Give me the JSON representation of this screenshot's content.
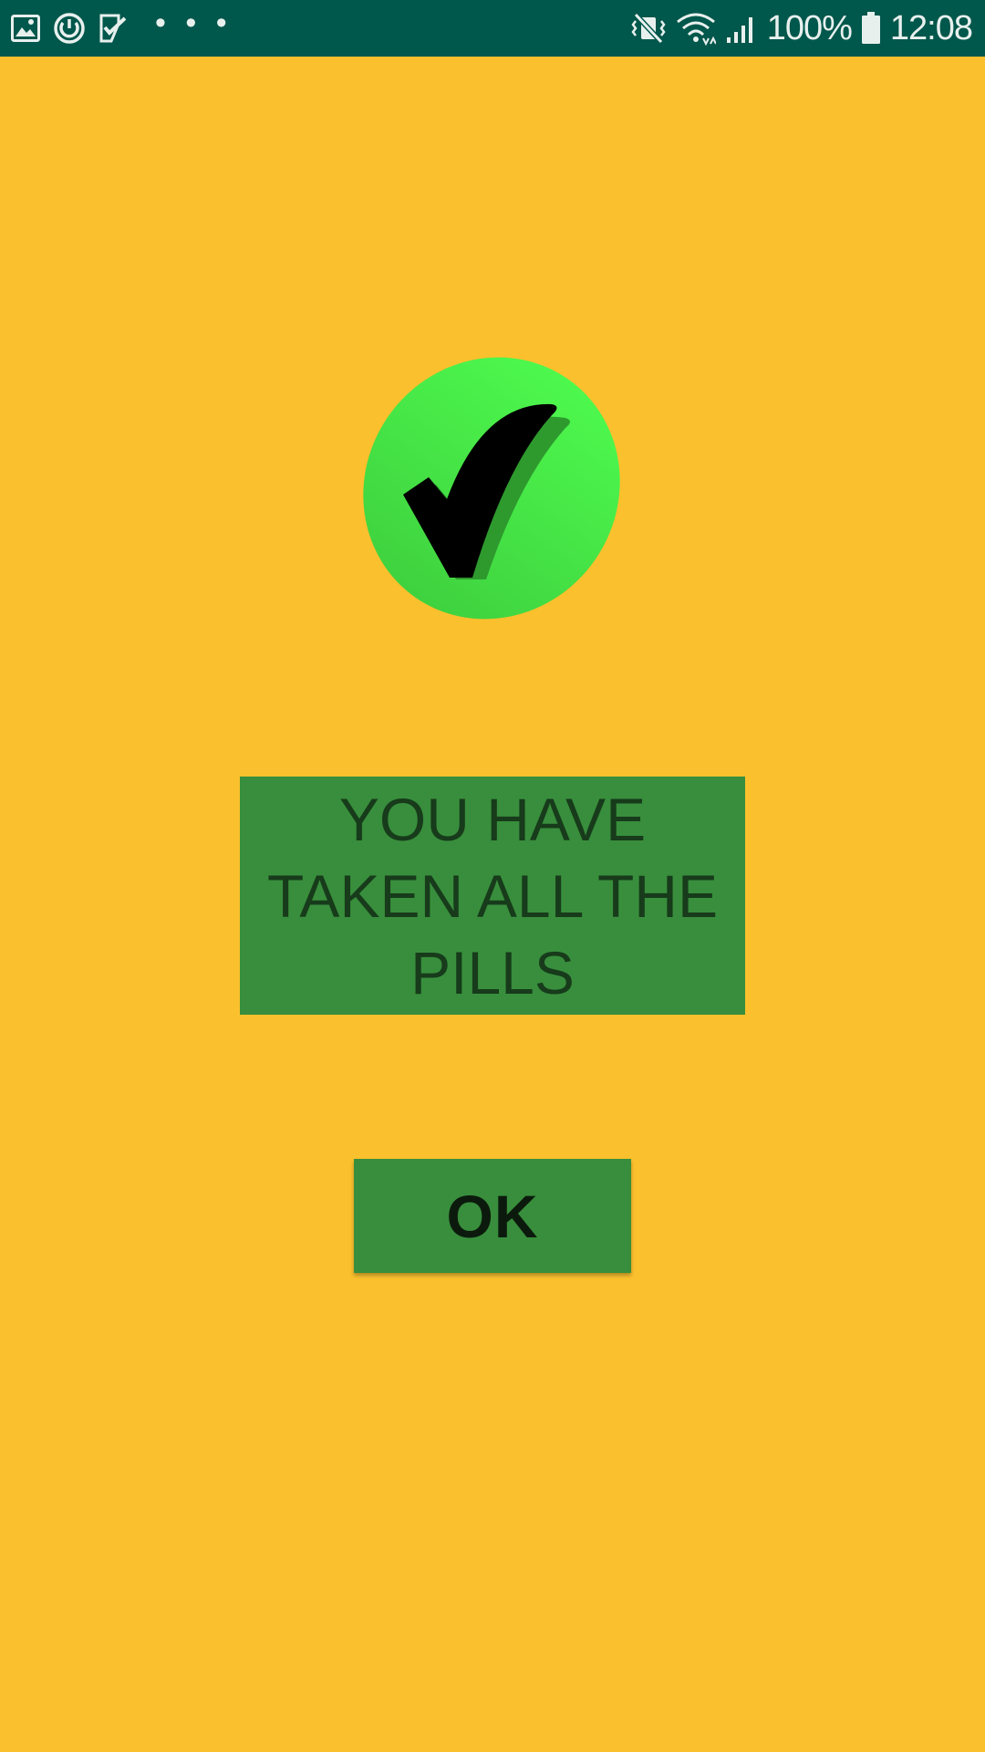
{
  "status_bar": {
    "left_icons": [
      "gallery-icon",
      "sync-icon",
      "task-check-icon"
    ],
    "more_indicator": "• • •",
    "right_icons": [
      "mute-vibrate-icon",
      "wifi-icon",
      "signal-icon"
    ],
    "battery": "100%",
    "time": "12:08"
  },
  "main": {
    "check_icon": "check-mark-icon",
    "message": "YOU HAVE TAKEN ALL THE PILLS",
    "ok_label": "OK"
  },
  "colors": {
    "background": "#FBC02D",
    "status_bar": "#00574B",
    "box_green": "#388E3C",
    "circle_green": "#4CEB4C",
    "check_black": "#000000"
  }
}
